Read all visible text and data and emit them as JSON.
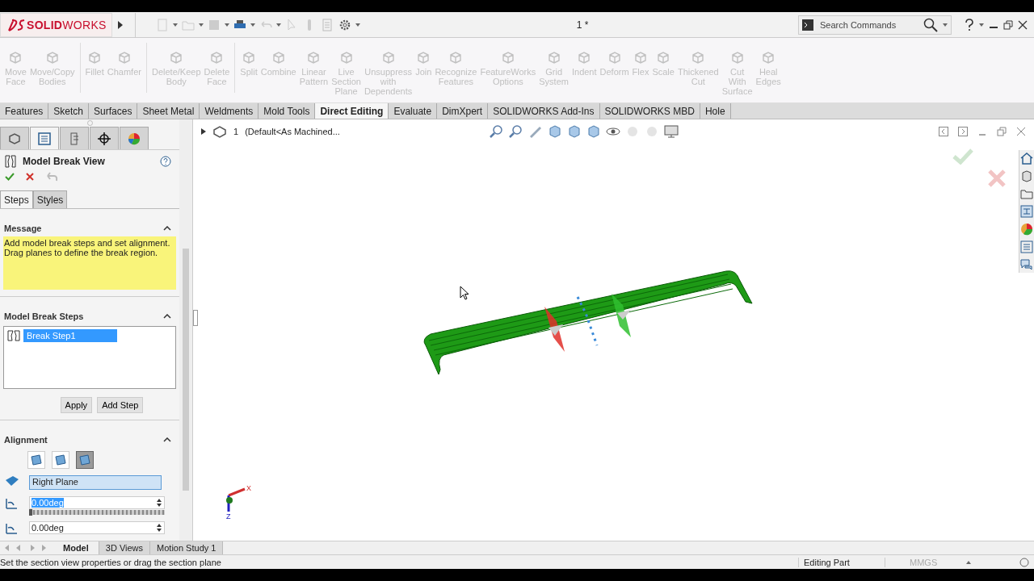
{
  "app": {
    "logo": "**SOLID**WORKS",
    "title": "1 *",
    "search": {
      "placeholder": "Search Commands"
    }
  },
  "ribbon": {
    "groups": [
      {
        "buttons": [
          {
            "label": "Move Face",
            "disabled": true
          },
          {
            "label": "Move/Copy Bodies",
            "disabled": true
          }
        ]
      },
      {
        "buttons": [
          {
            "label": "Fillet",
            "disabled": true
          },
          {
            "label": "Chamfer",
            "disabled": true
          }
        ]
      },
      {
        "buttons": [
          {
            "label": "Delete/Keep Body",
            "disabled": true
          },
          {
            "label": "Delete Face",
            "disabled": true
          }
        ]
      },
      {
        "buttons": [
          {
            "label": "Split",
            "disabled": true
          },
          {
            "label": "Combine",
            "disabled": true
          },
          {
            "label": "Linear Pattern",
            "disabled": true
          },
          {
            "label": "Live Section Plane",
            "disabled": true
          },
          {
            "label": "Unsuppress with Dependents",
            "disabled": true
          },
          {
            "label": "Join",
            "disabled": true
          },
          {
            "label": "Recognize Features",
            "disabled": true
          },
          {
            "label": "FeatureWorks Options",
            "disabled": true
          },
          {
            "label": "Grid System",
            "disabled": true
          },
          {
            "label": "Indent",
            "disabled": true
          },
          {
            "label": "Deform",
            "disabled": true
          },
          {
            "label": "Flex",
            "disabled": true
          },
          {
            "label": "Scale",
            "disabled": true
          },
          {
            "label": "Thickened Cut",
            "disabled": true
          },
          {
            "label": "Cut With Surface",
            "disabled": true
          },
          {
            "label": "Heal Edges",
            "disabled": true
          }
        ]
      }
    ]
  },
  "command_tabs": [
    {
      "label": "Features",
      "selected": false
    },
    {
      "label": "Sketch",
      "selected": false
    },
    {
      "label": "Surfaces",
      "selected": false
    },
    {
      "label": "Sheet Metal",
      "selected": false
    },
    {
      "label": "Weldments",
      "selected": false
    },
    {
      "label": "Mold Tools",
      "selected": false
    },
    {
      "label": "Direct Editing",
      "selected": true
    },
    {
      "label": "Evaluate",
      "selected": false
    },
    {
      "label": "DimXpert",
      "selected": false
    },
    {
      "label": "SOLIDWORKS Add-Ins",
      "selected": false
    },
    {
      "label": "SOLIDWORKS MBD",
      "selected": false
    },
    {
      "label": "Hole",
      "selected": false
    }
  ],
  "property_manager": {
    "panel_tabs": [
      {
        "selected": false
      },
      {
        "selected": true
      },
      {
        "selected": false
      },
      {
        "selected": false
      },
      {
        "selected": false
      }
    ],
    "title": "Model Break View",
    "steps_tabs": [
      {
        "label": "Steps",
        "selected": true
      },
      {
        "label": "Styles",
        "selected": false
      }
    ],
    "message": {
      "title": "Message",
      "expanded": true,
      "text": "Add model break steps and set alignment. Drag planes to define the break region."
    },
    "break_steps": {
      "title": "Model Break Steps",
      "expanded": true,
      "items": [
        {
          "label": "Break Step1",
          "selected": true
        }
      ],
      "buttons": [
        "Apply",
        "Add Step"
      ]
    },
    "alignment": {
      "title": "Alignment",
      "expanded": true,
      "options": [
        {
          "selected": false
        },
        {
          "selected": false
        },
        {
          "selected": true
        }
      ],
      "plane": "Right Plane",
      "angle_x": {
        "value": "0.00deg",
        "highlighted": true,
        "level": 0
      },
      "angle_y": {
        "value": "0.00deg",
        "highlighted": false
      }
    }
  },
  "view": {
    "breadcrumb_number": "1",
    "breadcrumb_config": "(Default<As Machined...",
    "triad": [
      "X",
      "Z"
    ]
  },
  "bottom_tabs": [
    {
      "label": "Model",
      "selected": true
    },
    {
      "label": "3D Views",
      "selected": false
    },
    {
      "label": "Motion Study 1",
      "selected": false
    }
  ],
  "status_bar": {
    "message": "Set the section view properties or drag the section plane",
    "mode": "Editing Part",
    "units": "MMGS"
  }
}
